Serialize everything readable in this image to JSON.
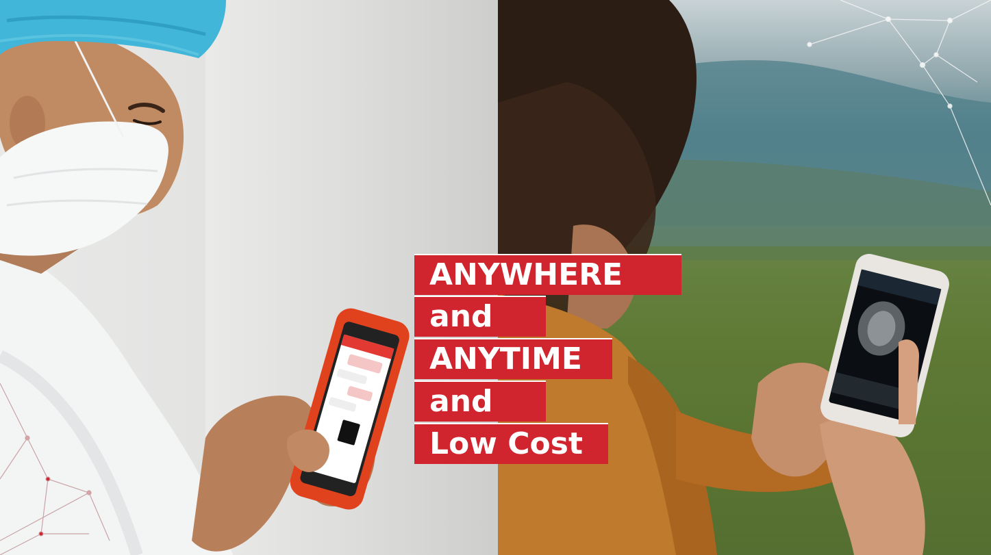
{
  "headline": {
    "lines": [
      "ANYWHERE",
      "and",
      "ANYTIME",
      "and",
      "Low Cost"
    ]
  },
  "colors": {
    "accent": "#d0252e",
    "headline_text": "#ffffff",
    "phone_case_left": "#e0421e",
    "scrubs": "#41b6d8"
  },
  "illustrations": {
    "left_photo": "healthcare-worker-using-phone",
    "right_photo": "person-outdoors-viewing-mri-on-phone",
    "network_graphic": "network-lines-icon"
  }
}
